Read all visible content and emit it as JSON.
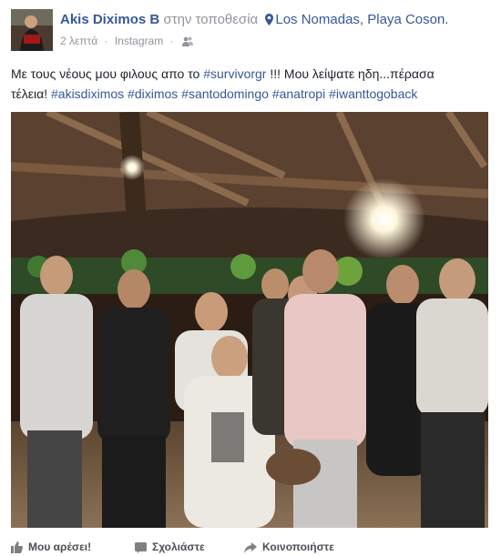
{
  "post": {
    "author": "Akis Diximos B",
    "at_location_text": "στην τοποθεσία",
    "location": "Los Nomadas, Playa Coson.",
    "time": "2 λεπτά",
    "separator": "·",
    "source": "Instagram",
    "audience_icon": "friends-icon",
    "text_part1": "Με τους νέους μου φιλους απο το",
    "hashtag_survivor": "#survivorgr",
    "text_part2": "!!! Μου λείψατε ηδη...πέρασα",
    "text_part3": "τέλεια!",
    "hashtags": [
      "#akisdiximos",
      "#diximos",
      "#santodomingo",
      "#anatropi",
      "#iwanttogoback"
    ],
    "photo_icon": "group-photo"
  },
  "actions": {
    "like_label": "Μου αρέσει!",
    "comment_label": "Σχολιάστε",
    "share_label": "Κοινοποιήστε"
  },
  "colors": {
    "link": "#365899",
    "meta": "#90949c",
    "text": "#1d2129"
  }
}
